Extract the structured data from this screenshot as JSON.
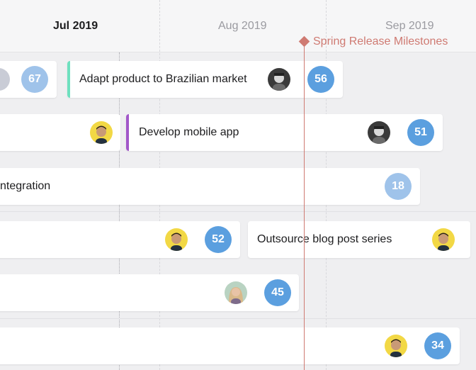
{
  "timeline": {
    "months": [
      {
        "label": "Jul 2019",
        "current": true
      },
      {
        "label": "Aug 2019",
        "current": false
      },
      {
        "label": "Sep 2019",
        "current": false
      }
    ]
  },
  "milestone": {
    "label": "Spring Release Milestones",
    "color": "#cf7a72"
  },
  "cards": [
    {
      "title": "",
      "badge": "67",
      "badge_color": "#9fc3ea"
    },
    {
      "title": "Adapt product to Brazilian market",
      "badge": "56",
      "badge_color": "#5b9fdf",
      "accent_color": "#6ee0bf"
    },
    {
      "title": "",
      "badge": "",
      "avatar": "yellow"
    },
    {
      "title": "Develop mobile app",
      "badge": "51",
      "badge_color": "#5b9fdf",
      "accent_color": "#a257c9"
    },
    {
      "title": "ntegration",
      "badge": "18",
      "badge_color": "#9fc3ea"
    },
    {
      "title": "",
      "badge": "52",
      "badge_color": "#5b9fdf"
    },
    {
      "title": "Outsource blog post series",
      "badge": ""
    },
    {
      "title": "",
      "badge": "45",
      "badge_color": "#5b9fdf"
    },
    {
      "title": "",
      "badge": "34",
      "badge_color": "#5b9fdf"
    }
  ]
}
